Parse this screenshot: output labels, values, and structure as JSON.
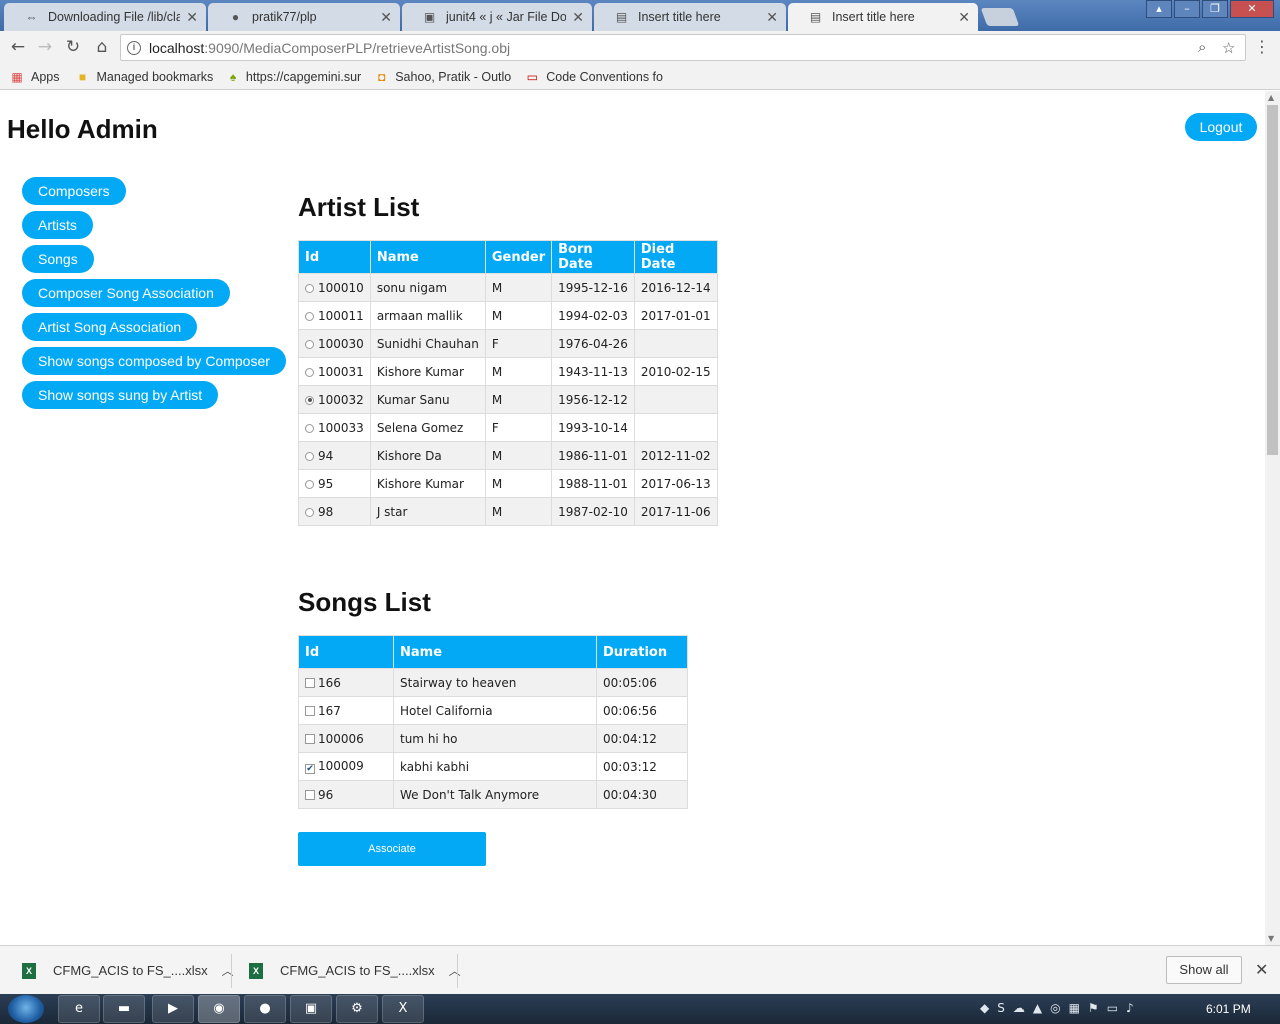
{
  "browser": {
    "tabs": [
      {
        "title": "Downloading File /lib/cla",
        "icon": "download-page-icon",
        "active": false
      },
      {
        "title": "pratik77/plp",
        "icon": "github-icon",
        "active": false
      },
      {
        "title": "junit4 « j « Jar File Downl",
        "icon": "jar-page-icon",
        "active": false
      },
      {
        "title": "Insert title here",
        "icon": "page-icon",
        "active": false
      },
      {
        "title": "Insert title here",
        "icon": "page-icon",
        "active": true
      }
    ],
    "url_host": "localhost",
    "url_path": ":9090/MediaComposerPLP/retrieveArtistSong.obj",
    "bookmarks": [
      {
        "label": "Apps",
        "icon": "apps-grid-icon"
      },
      {
        "label": "Managed bookmarks",
        "icon": "folder-icon"
      },
      {
        "label": "https://capgemini.sur",
        "icon": "capgemini-icon"
      },
      {
        "label": "Sahoo, Pratik - Outlo",
        "icon": "outlook-icon"
      },
      {
        "label": "Code Conventions fo",
        "icon": "oracle-icon"
      }
    ]
  },
  "header": {
    "greeting": "Hello Admin",
    "logout_label": "Logout"
  },
  "sidenav": [
    "Composers",
    "Artists",
    "Songs",
    "Composer Song Association",
    "Artist Song Association",
    "Show songs composed by Composer",
    "Show songs sung by Artist"
  ],
  "artist_list": {
    "title": "Artist List",
    "columns": [
      "Id",
      "Name",
      "Gender",
      "Born Date",
      "Died Date"
    ],
    "rows": [
      {
        "id": "100010",
        "name": "sonu nigam",
        "gender": "M",
        "born": "1995-12-16",
        "died": "2016-12-14",
        "selected": false
      },
      {
        "id": "100011",
        "name": "armaan mallik",
        "gender": "M",
        "born": "1994-02-03",
        "died": "2017-01-01",
        "selected": false
      },
      {
        "id": "100030",
        "name": "Sunidhi Chauhan",
        "gender": "F",
        "born": "1976-04-26",
        "died": "",
        "selected": false
      },
      {
        "id": "100031",
        "name": "Kishore Kumar",
        "gender": "M",
        "born": "1943-11-13",
        "died": "2010-02-15",
        "selected": false
      },
      {
        "id": "100032",
        "name": "Kumar Sanu",
        "gender": "M",
        "born": "1956-12-12",
        "died": "",
        "selected": true
      },
      {
        "id": "100033",
        "name": "Selena Gomez",
        "gender": "F",
        "born": "1993-10-14",
        "died": "",
        "selected": false
      },
      {
        "id": "94",
        "name": "Kishore Da",
        "gender": "M",
        "born": "1986-11-01",
        "died": "2012-11-02",
        "selected": false
      },
      {
        "id": "95",
        "name": "Kishore Kumar",
        "gender": "M",
        "born": "1988-11-01",
        "died": "2017-06-13",
        "selected": false
      },
      {
        "id": "98",
        "name": "J star",
        "gender": "M",
        "born": "1987-02-10",
        "died": "2017-11-06",
        "selected": false
      }
    ]
  },
  "songs_list": {
    "title": "Songs List",
    "columns": [
      "Id",
      "Name",
      "Duration"
    ],
    "rows": [
      {
        "id": "166",
        "name": "Stairway to heaven",
        "duration": "00:05:06",
        "checked": false
      },
      {
        "id": "167",
        "name": "Hotel California",
        "duration": "00:06:56",
        "checked": false
      },
      {
        "id": "100006",
        "name": "tum hi ho",
        "duration": "00:04:12",
        "checked": false
      },
      {
        "id": "100009",
        "name": "kabhi kabhi",
        "duration": "00:03:12",
        "checked": true
      },
      {
        "id": "96",
        "name": "We Don't Talk Anymore",
        "duration": "00:04:30",
        "checked": false
      }
    ]
  },
  "associate_label": "Associate",
  "downloads": {
    "items": [
      "CFMG_ACIS to FS_....xlsx",
      "CFMG_ACIS to FS_....xlsx"
    ],
    "show_all_label": "Show all"
  },
  "taskbar": {
    "clock": "6:01 PM"
  },
  "colors": {
    "accent": "#03a9f4"
  }
}
